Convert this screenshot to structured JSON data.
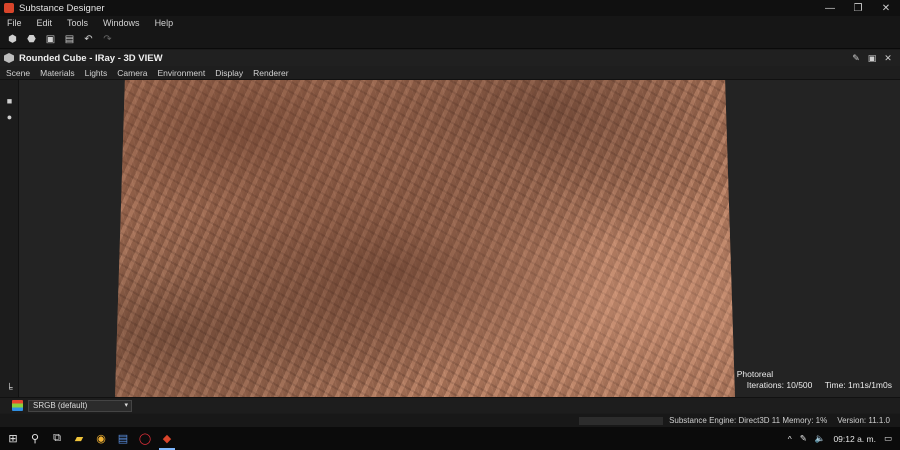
{
  "app": {
    "title": "Substance Designer",
    "logo_icon": "substance-designer-logo-icon"
  },
  "window_controls": {
    "minimize": "—",
    "restore": "❐",
    "close": "✕"
  },
  "menu": [
    "File",
    "Edit",
    "Tools",
    "Windows",
    "Help"
  ],
  "toolbar": {
    "icons": [
      "new-package-icon",
      "open-icon",
      "save-icon",
      "save-all-icon",
      "undo-icon",
      "redo-icon"
    ],
    "glyphs": [
      "⬢",
      "⬣",
      "▣",
      "▤",
      "↶",
      "↷"
    ]
  },
  "panel": {
    "title": "Rounded Cube - IRay - 3D VIEW",
    "icons": [
      "pin-icon",
      "float-icon",
      "close-icon"
    ],
    "glyphs": [
      "✎",
      "▣",
      "✕"
    ],
    "view_menu": [
      "Scene",
      "Materials",
      "Lights",
      "Camera",
      "Environment",
      "Display",
      "Renderer"
    ]
  },
  "left_strip": {
    "icons": [
      "camera-icon",
      "light-icon",
      "scene-tree-icon"
    ],
    "glyphs": [
      "■",
      "●",
      "╘"
    ]
  },
  "render_overlay": {
    "mode": "Photoreal",
    "iterations": "Iterations: 10/500",
    "time": "Time: 1m1s/1m0s"
  },
  "colorspace": {
    "selected": "SRGB (default)",
    "caret": "▾"
  },
  "status": {
    "engine": "Substance Engine: Direct3D 11  Memory: 1%",
    "version": "Version: 11.1.0"
  },
  "taskbar": {
    "icons": [
      "start-icon",
      "search-icon",
      "task-view-icon",
      "file-explorer-icon",
      "chrome-icon",
      "word-icon",
      "opera-icon",
      "substance-designer-taskbar-icon"
    ],
    "glyphs": [
      "⊞",
      "⚲",
      "⧉",
      "▰",
      "◉",
      "▤",
      "◯",
      "◆"
    ],
    "tray": {
      "chevron": "^",
      "pen": "✎",
      "volume": "🔈",
      "time": "09:12 a. m.",
      "notification": "▭"
    }
  },
  "colors": {
    "accent": "#d9452b",
    "rock_base": "#b07a5e"
  }
}
